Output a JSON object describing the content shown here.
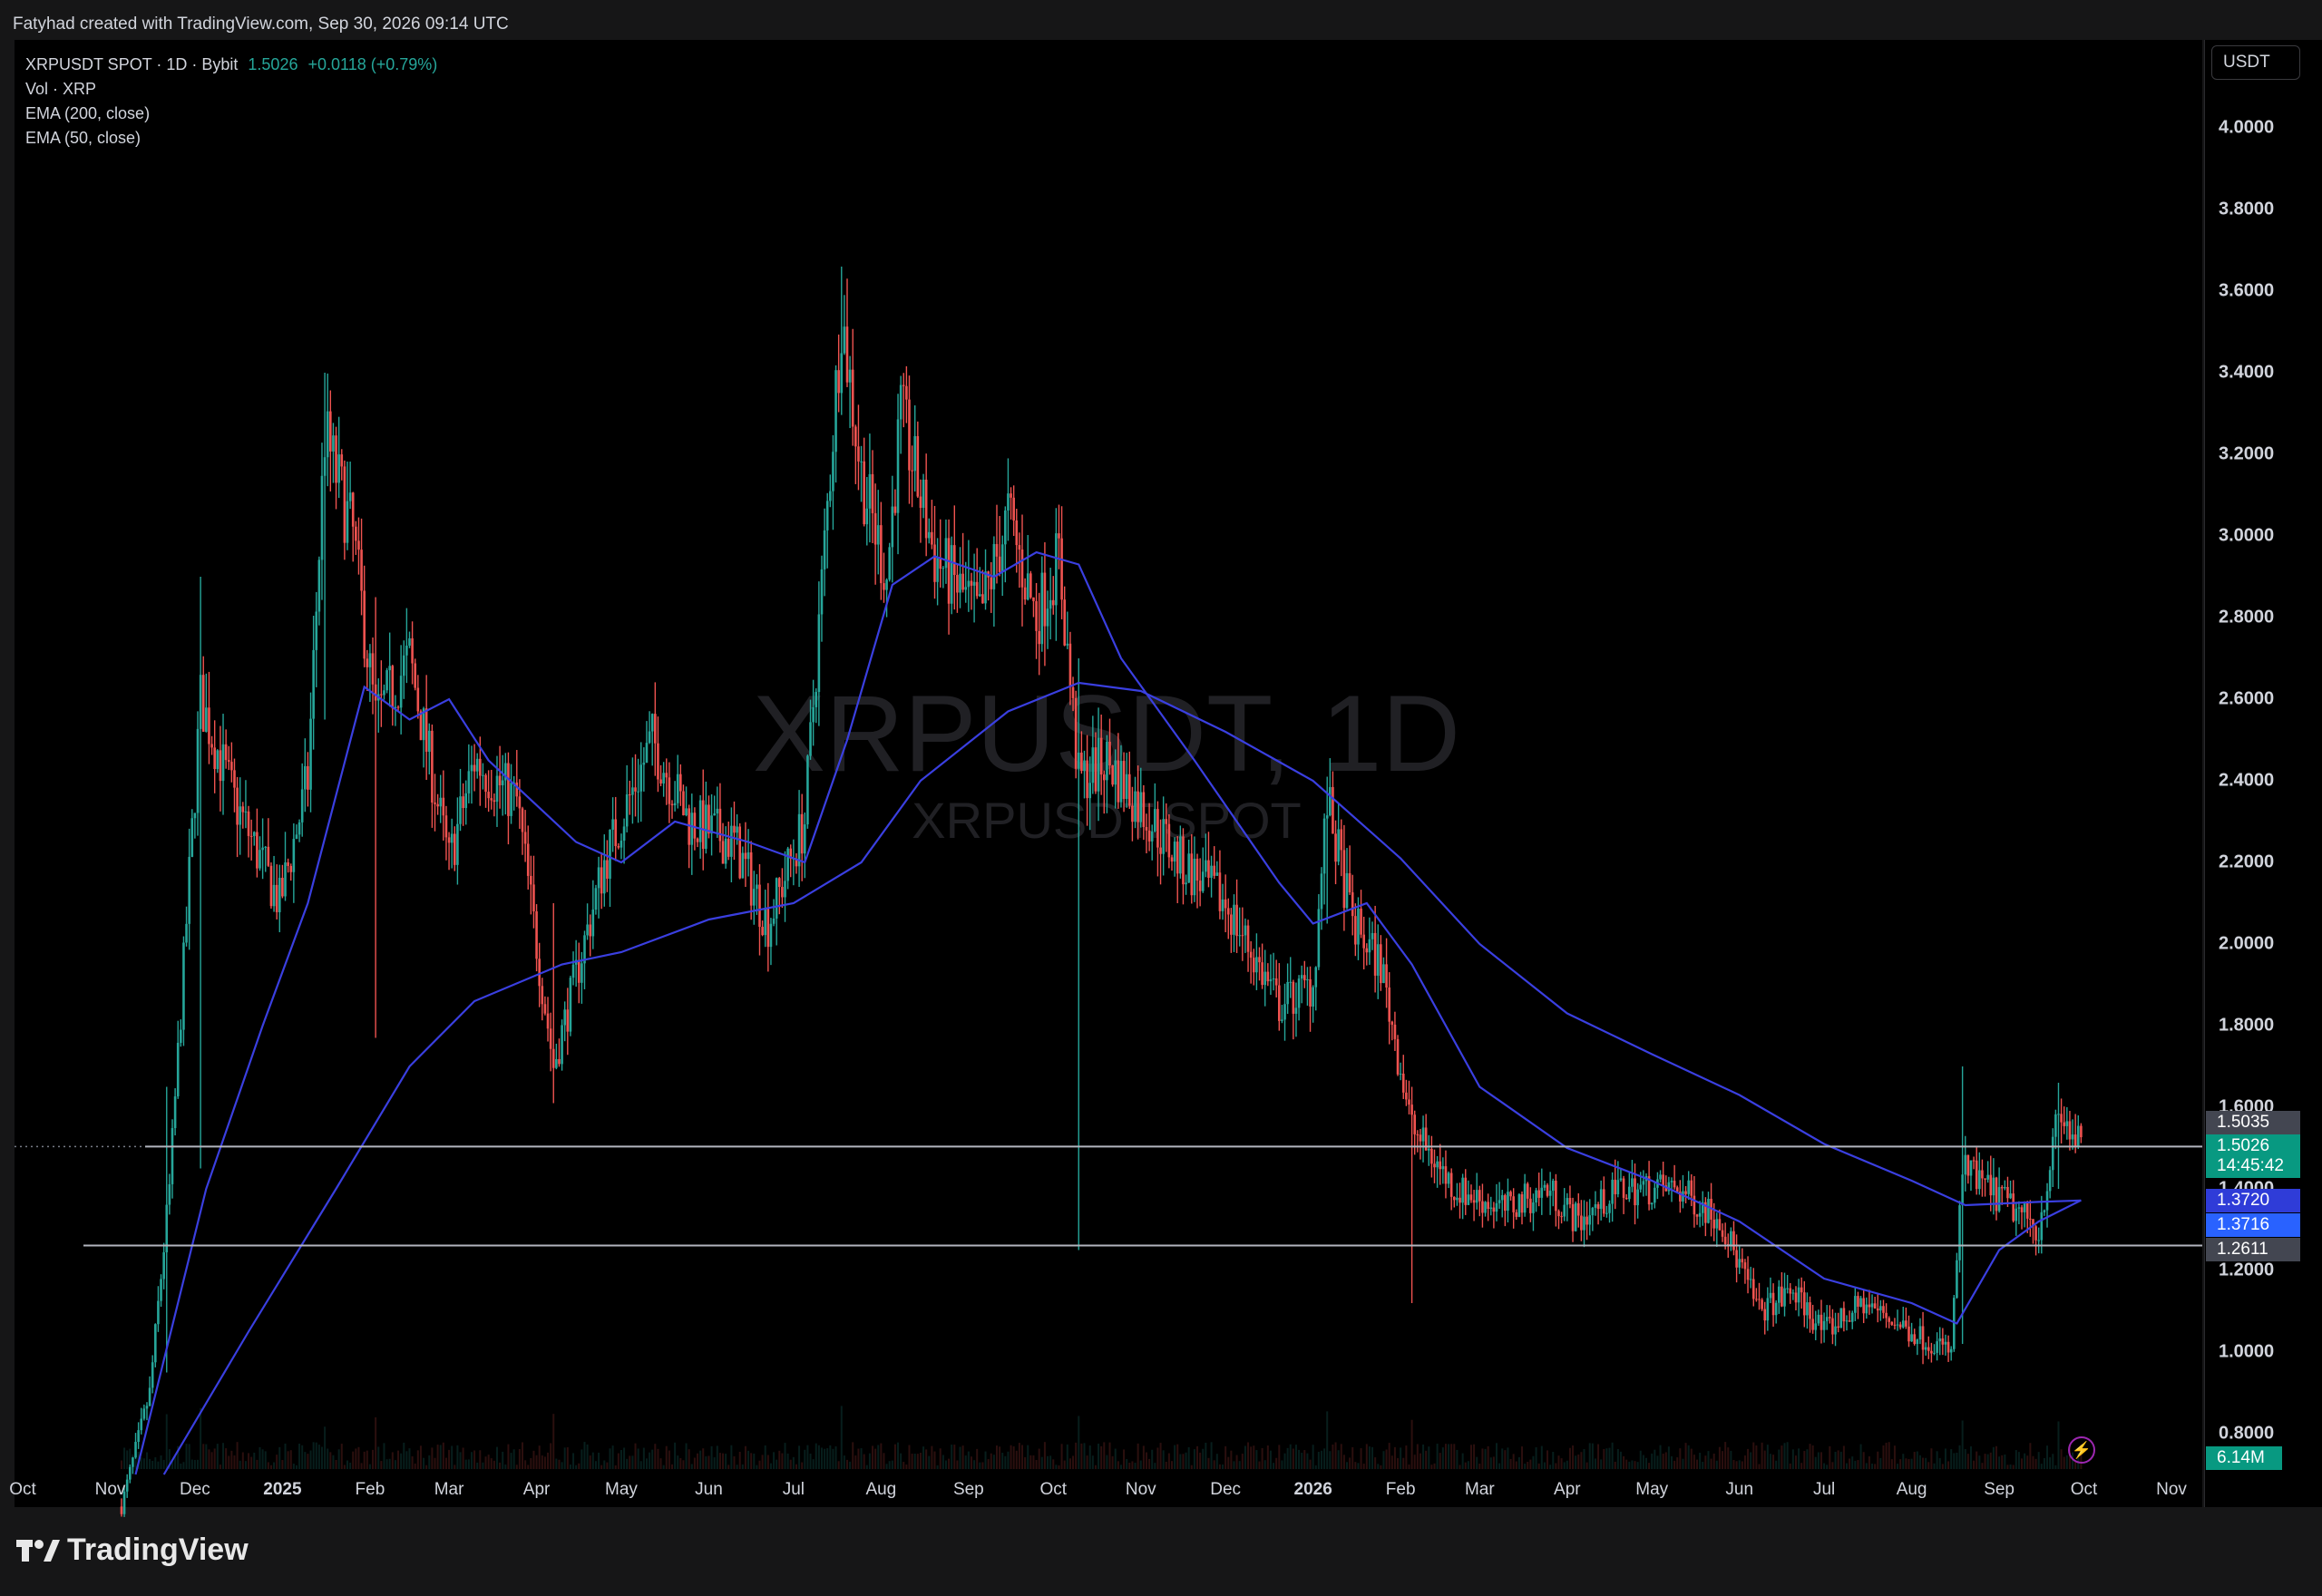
{
  "header": {
    "credit": "Fatyhad created with TradingView.com, Sep 30, 2026 09:14 UTC"
  },
  "legend": {
    "symbol": "XRPUSDT SPOT · 1D · Bybit",
    "last": "1.5026",
    "change": "+0.0118 (+0.79%)",
    "vol": "Vol · XRP",
    "ema200": "EMA (200, close)",
    "ema50": "EMA (50, close)"
  },
  "price_axis": {
    "currency": "USDT",
    "ticks": [
      "4.0000",
      "3.8000",
      "3.6000",
      "3.4000",
      "3.2000",
      "3.0000",
      "2.8000",
      "2.6000",
      "2.4000",
      "2.2000",
      "2.0000",
      "1.8000",
      "1.6000",
      "1.4000",
      "1.2000",
      "1.0000",
      "0.8000"
    ]
  },
  "time_axis": {
    "labels": [
      {
        "t": "Oct",
        "bold": false
      },
      {
        "t": "Nov",
        "bold": false
      },
      {
        "t": "Dec",
        "bold": false
      },
      {
        "t": "2025",
        "bold": true
      },
      {
        "t": "Feb",
        "bold": false
      },
      {
        "t": "Mar",
        "bold": false
      },
      {
        "t": "Apr",
        "bold": false
      },
      {
        "t": "May",
        "bold": false
      },
      {
        "t": "Jun",
        "bold": false
      },
      {
        "t": "Jul",
        "bold": false
      },
      {
        "t": "Aug",
        "bold": false
      },
      {
        "t": "Sep",
        "bold": false
      },
      {
        "t": "Oct",
        "bold": false
      },
      {
        "t": "Nov",
        "bold": false
      },
      {
        "t": "Dec",
        "bold": false
      },
      {
        "t": "2026",
        "bold": true
      },
      {
        "t": "Feb",
        "bold": false
      },
      {
        "t": "Mar",
        "bold": false
      },
      {
        "t": "Apr",
        "bold": false
      },
      {
        "t": "May",
        "bold": false
      },
      {
        "t": "Jun",
        "bold": false
      },
      {
        "t": "Jul",
        "bold": false
      },
      {
        "t": "Aug",
        "bold": false
      },
      {
        "t": "Sep",
        "bold": false
      },
      {
        "t": "Oct",
        "bold": false
      },
      {
        "t": "Nov",
        "bold": false
      }
    ]
  },
  "tags": {
    "level_high": "1.5035",
    "last_price": "1.5026",
    "countdown": "14:45:42",
    "ema50_value": "1.3720",
    "ema200_value": "1.3716",
    "level_low": "1.2611",
    "volume": "6.14M"
  },
  "watermark": {
    "main": "XRPUSDT, 1D",
    "sub": "XRPUSDT.SPOT"
  },
  "footer": {
    "brand": "TradingView"
  },
  "colors": {
    "up": "#26a69a",
    "down": "#ef5350",
    "ema": "#3a3fe0",
    "tag_green": "#089981",
    "tag_blue": "#2962ff",
    "background": "#000000"
  },
  "chart_data": {
    "type": "candlestick",
    "symbol": "XRPUSDT SPOT",
    "interval": "1D",
    "exchange": "Bybit",
    "x_axis": "date",
    "ylim": [
      0.72,
      4.18
    ],
    "y_ticks": [
      0.8,
      1.0,
      1.2,
      1.4,
      1.6,
      1.8,
      2.0,
      2.2,
      2.4,
      2.6,
      2.8,
      3.0,
      3.2,
      3.4,
      3.6,
      3.8,
      4.0
    ],
    "close_path": [
      {
        "date": "2024-11-01",
        "close": 0.51
      },
      {
        "date": "2024-11-15",
        "close": 0.9
      },
      {
        "date": "2024-11-22",
        "close": 1.4
      },
      {
        "date": "2024-12-03",
        "close": 2.6
      },
      {
        "date": "2024-12-15",
        "close": 2.35
      },
      {
        "date": "2024-12-31",
        "close": 2.1
      },
      {
        "date": "2025-01-10",
        "close": 2.4
      },
      {
        "date": "2025-01-16",
        "close": 3.25
      },
      {
        "date": "2025-01-26",
        "close": 3.0
      },
      {
        "date": "2025-02-03",
        "close": 2.55
      },
      {
        "date": "2025-02-15",
        "close": 2.7
      },
      {
        "date": "2025-03-01",
        "close": 2.2
      },
      {
        "date": "2025-03-10",
        "close": 2.45
      },
      {
        "date": "2025-03-25",
        "close": 2.35
      },
      {
        "date": "2025-04-07",
        "close": 1.7
      },
      {
        "date": "2025-04-25",
        "close": 2.2
      },
      {
        "date": "2025-05-12",
        "close": 2.5
      },
      {
        "date": "2025-05-25",
        "close": 2.3
      },
      {
        "date": "2025-06-10",
        "close": 2.25
      },
      {
        "date": "2025-06-22",
        "close": 2.05
      },
      {
        "date": "2025-07-05",
        "close": 2.3
      },
      {
        "date": "2025-07-18",
        "close": 3.55
      },
      {
        "date": "2025-07-25",
        "close": 3.15
      },
      {
        "date": "2025-08-03",
        "close": 2.9
      },
      {
        "date": "2025-08-08",
        "close": 3.3
      },
      {
        "date": "2025-08-20",
        "close": 2.95
      },
      {
        "date": "2025-09-05",
        "close": 2.8
      },
      {
        "date": "2025-09-15",
        "close": 3.05
      },
      {
        "date": "2025-09-25",
        "close": 2.8
      },
      {
        "date": "2025-10-03",
        "close": 2.95
      },
      {
        "date": "2025-10-10",
        "close": 2.4
      },
      {
        "date": "2025-10-20",
        "close": 2.45
      },
      {
        "date": "2025-11-05",
        "close": 2.3
      },
      {
        "date": "2025-11-15",
        "close": 2.2
      },
      {
        "date": "2025-12-01",
        "close": 2.1
      },
      {
        "date": "2025-12-20",
        "close": 1.85
      },
      {
        "date": "2026-01-01",
        "close": 1.9
      },
      {
        "date": "2026-01-06",
        "close": 2.35
      },
      {
        "date": "2026-01-15",
        "close": 2.05
      },
      {
        "date": "2026-01-25",
        "close": 1.95
      },
      {
        "date": "2026-02-05",
        "close": 1.55
      },
      {
        "date": "2026-02-20",
        "close": 1.4
      },
      {
        "date": "2026-03-10",
        "close": 1.35
      },
      {
        "date": "2026-03-25",
        "close": 1.4
      },
      {
        "date": "2026-04-05",
        "close": 1.32
      },
      {
        "date": "2026-04-20",
        "close": 1.4
      },
      {
        "date": "2026-05-10",
        "close": 1.4
      },
      {
        "date": "2026-05-25",
        "close": 1.33
      },
      {
        "date": "2026-06-08",
        "close": 1.1
      },
      {
        "date": "2026-06-20",
        "close": 1.15
      },
      {
        "date": "2026-07-01",
        "close": 1.05
      },
      {
        "date": "2026-07-15",
        "close": 1.12
      },
      {
        "date": "2026-08-01",
        "close": 1.05
      },
      {
        "date": "2026-08-15",
        "close": 1.0
      },
      {
        "date": "2026-08-19",
        "close": 1.45
      },
      {
        "date": "2026-09-01",
        "close": 1.38
      },
      {
        "date": "2026-09-15",
        "close": 1.3
      },
      {
        "date": "2026-09-22",
        "close": 1.58
      },
      {
        "date": "2026-09-30",
        "close": 1.5026
      }
    ],
    "spikes": [
      {
        "date": "2024-11-21",
        "low": 0.95,
        "high": 1.65
      },
      {
        "date": "2024-12-03",
        "low": 1.45,
        "high": 2.9
      },
      {
        "date": "2025-01-16",
        "low": 2.55,
        "high": 3.4
      },
      {
        "date": "2025-02-03",
        "low": 1.77,
        "high": 2.85
      },
      {
        "date": "2025-04-07",
        "low": 1.61,
        "high": 2.1
      },
      {
        "date": "2025-07-18",
        "low": 3.3,
        "high": 3.66
      },
      {
        "date": "2025-10-10",
        "low": 1.25,
        "high": 2.7
      },
      {
        "date": "2026-01-06",
        "low": 2.05,
        "high": 2.41
      },
      {
        "date": "2026-02-05",
        "low": 1.12,
        "high": 1.65
      },
      {
        "date": "2026-08-19",
        "low": 1.02,
        "high": 1.7
      },
      {
        "date": "2026-09-22",
        "low": 1.4,
        "high": 1.66
      }
    ],
    "ema50": [
      {
        "date": "2024-11-10",
        "v": 0.7
      },
      {
        "date": "2024-12-05",
        "v": 1.4
      },
      {
        "date": "2024-12-25",
        "v": 1.8
      },
      {
        "date": "2025-01-10",
        "v": 2.1
      },
      {
        "date": "2025-01-30",
        "v": 2.63
      },
      {
        "date": "2025-02-15",
        "v": 2.55
      },
      {
        "date": "2025-03-01",
        "v": 2.6
      },
      {
        "date": "2025-03-15",
        "v": 2.45
      },
      {
        "date": "2025-04-15",
        "v": 2.25
      },
      {
        "date": "2025-05-01",
        "v": 2.2
      },
      {
        "date": "2025-05-20",
        "v": 2.3
      },
      {
        "date": "2025-06-15",
        "v": 2.25
      },
      {
        "date": "2025-07-05",
        "v": 2.2
      },
      {
        "date": "2025-07-20",
        "v": 2.5
      },
      {
        "date": "2025-08-05",
        "v": 2.88
      },
      {
        "date": "2025-08-20",
        "v": 2.95
      },
      {
        "date": "2025-09-10",
        "v": 2.9
      },
      {
        "date": "2025-09-25",
        "v": 2.96
      },
      {
        "date": "2025-10-10",
        "v": 2.93
      },
      {
        "date": "2025-10-25",
        "v": 2.7
      },
      {
        "date": "2025-11-20",
        "v": 2.45
      },
      {
        "date": "2025-12-20",
        "v": 2.15
      },
      {
        "date": "2026-01-01",
        "v": 2.05
      },
      {
        "date": "2026-01-20",
        "v": 2.1
      },
      {
        "date": "2026-02-05",
        "v": 1.95
      },
      {
        "date": "2026-03-01",
        "v": 1.65
      },
      {
        "date": "2026-04-01",
        "v": 1.5
      },
      {
        "date": "2026-05-01",
        "v": 1.42
      },
      {
        "date": "2026-06-01",
        "v": 1.32
      },
      {
        "date": "2026-07-01",
        "v": 1.18
      },
      {
        "date": "2026-08-01",
        "v": 1.12
      },
      {
        "date": "2026-08-17",
        "v": 1.07
      },
      {
        "date": "2026-09-01",
        "v": 1.25
      },
      {
        "date": "2026-09-15",
        "v": 1.32
      },
      {
        "date": "2026-09-30",
        "v": 1.372
      }
    ],
    "ema200": [
      {
        "date": "2024-11-20",
        "v": 0.7
      },
      {
        "date": "2024-12-20",
        "v": 1.05
      },
      {
        "date": "2025-01-20",
        "v": 1.4
      },
      {
        "date": "2025-02-15",
        "v": 1.7
      },
      {
        "date": "2025-03-10",
        "v": 1.86
      },
      {
        "date": "2025-04-10",
        "v": 1.95
      },
      {
        "date": "2025-05-01",
        "v": 1.98
      },
      {
        "date": "2025-06-01",
        "v": 2.06
      },
      {
        "date": "2025-07-01",
        "v": 2.1
      },
      {
        "date": "2025-07-25",
        "v": 2.2
      },
      {
        "date": "2025-08-15",
        "v": 2.4
      },
      {
        "date": "2025-09-15",
        "v": 2.57
      },
      {
        "date": "2025-10-10",
        "v": 2.64
      },
      {
        "date": "2025-11-01",
        "v": 2.62
      },
      {
        "date": "2025-12-01",
        "v": 2.52
      },
      {
        "date": "2026-01-01",
        "v": 2.4
      },
      {
        "date": "2026-02-01",
        "v": 2.21
      },
      {
        "date": "2026-03-01",
        "v": 2.0
      },
      {
        "date": "2026-04-01",
        "v": 1.83
      },
      {
        "date": "2026-05-01",
        "v": 1.73
      },
      {
        "date": "2026-06-01",
        "v": 1.63
      },
      {
        "date": "2026-07-01",
        "v": 1.51
      },
      {
        "date": "2026-08-01",
        "v": 1.42
      },
      {
        "date": "2026-08-20",
        "v": 1.36
      },
      {
        "date": "2026-09-15",
        "v": 1.368
      },
      {
        "date": "2026-09-30",
        "v": 1.3716
      }
    ],
    "horizontal_levels": [
      1.5035,
      1.2611
    ]
  }
}
